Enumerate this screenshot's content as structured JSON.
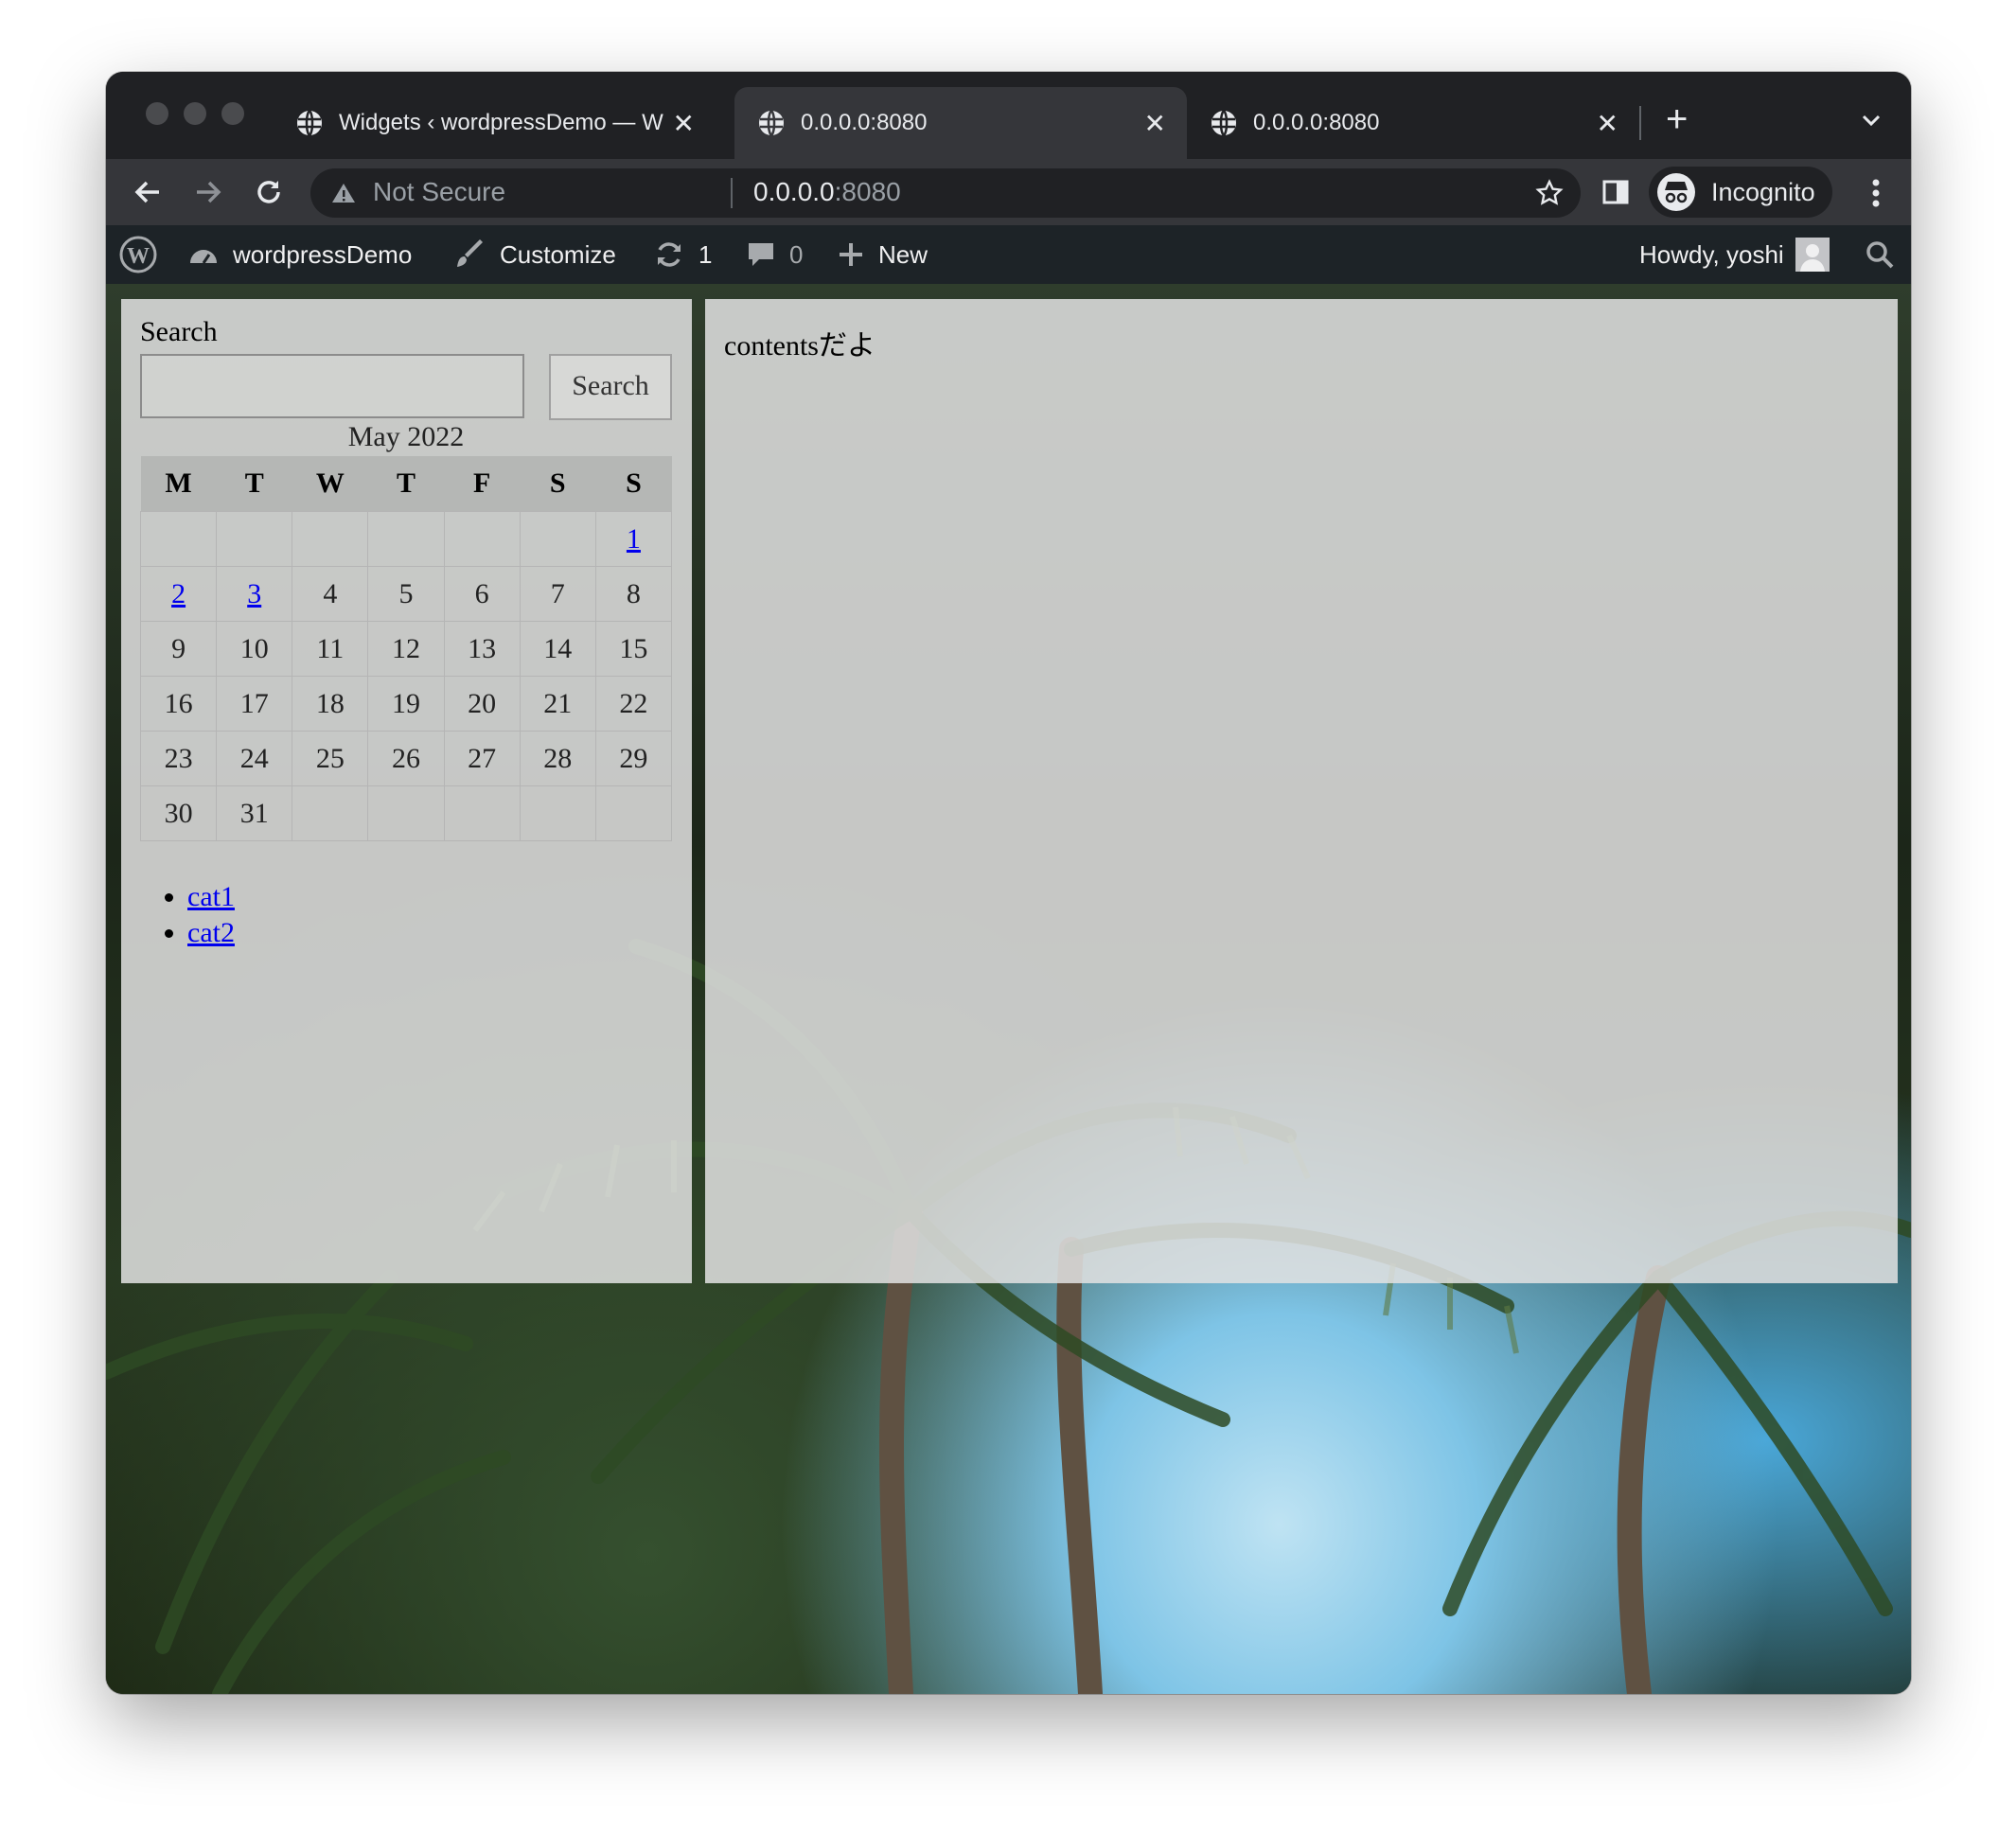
{
  "browser": {
    "tabs": [
      {
        "title": "Widgets ‹ wordpressDemo — W",
        "active": false
      },
      {
        "title": "0.0.0.0:8080",
        "active": true
      },
      {
        "title": "0.0.0.0:8080",
        "active": false
      }
    ],
    "new_tab_symbol": "+",
    "close_symbol": "✕",
    "address": {
      "security_label": "Not Secure",
      "host": "0.0.0.0",
      "port": ":8080"
    },
    "profile_label": "Incognito"
  },
  "adminbar": {
    "site_name": "wordpressDemo",
    "customize": "Customize",
    "updates_count": "1",
    "comments_count": "0",
    "new_label": "New",
    "howdy": "Howdy, yoshi"
  },
  "sidebar": {
    "search_label": "Search",
    "search_value": "",
    "search_button": "Search",
    "calendar": {
      "caption": "May 2022",
      "weekdays": [
        "M",
        "T",
        "W",
        "T",
        "F",
        "S",
        "S"
      ],
      "weeks": [
        [
          "",
          "",
          "",
          "",
          "",
          "",
          "1"
        ],
        [
          "2",
          "3",
          "4",
          "5",
          "6",
          "7",
          "8"
        ],
        [
          "9",
          "10",
          "11",
          "12",
          "13",
          "14",
          "15"
        ],
        [
          "16",
          "17",
          "18",
          "19",
          "20",
          "21",
          "22"
        ],
        [
          "23",
          "24",
          "25",
          "26",
          "27",
          "28",
          "29"
        ],
        [
          "30",
          "31",
          "",
          "",
          "",
          "",
          ""
        ]
      ],
      "linked_days": [
        "1",
        "2",
        "3"
      ]
    },
    "categories": [
      "cat1",
      "cat2"
    ]
  },
  "main": {
    "content": "contentsだよ"
  },
  "colors": {
    "toolbar": "#35363a",
    "tabstrip": "#202124",
    "adminbar": "#1d2327",
    "link": "#0000ee",
    "panel": "#e2e2e2"
  },
  "icons": [
    "globe-icon",
    "close-icon",
    "plus-icon",
    "chevron-down-icon",
    "back-arrow-icon",
    "forward-arrow-icon",
    "reload-icon",
    "warning-icon",
    "star-icon",
    "side-panel-icon",
    "incognito-icon",
    "kebab-menu-icon",
    "wordpress-logo-icon",
    "dashboard-icon",
    "brush-icon",
    "refresh-icon",
    "comment-icon",
    "avatar-icon",
    "search-icon"
  ]
}
